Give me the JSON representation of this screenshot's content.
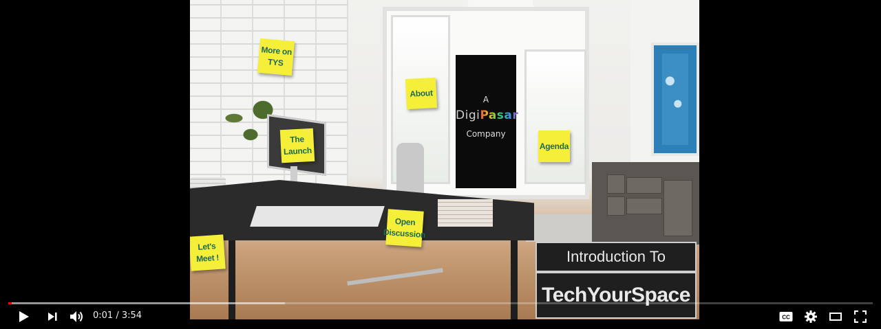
{
  "video": {
    "notes": {
      "more_on_tys": "More on\nTYS",
      "about": "About",
      "the_launch": "The\nLaunch",
      "agenda": "Agenda",
      "open_discussion": "Open\nDiscussion",
      "lets_meet": "Let's\nMeet !"
    },
    "sign": {
      "a": "A",
      "brand_part1": "Digi",
      "brand_part2": "Pasar",
      "company": "Company"
    },
    "title_card": {
      "line1": "Introduction To",
      "line2": "TechYourSpace"
    },
    "colors": {
      "note_yellow": "#f6ef3a",
      "note_text": "#1d6b56"
    }
  },
  "controls": {
    "time_current": "0:01",
    "time_separator": " / ",
    "time_total": "3:54",
    "progress_played_fraction": 0.004,
    "progress_buffered_fraction": 0.32,
    "accent_color": "#ff0000",
    "icons": [
      "play-icon",
      "next-icon",
      "volume-icon",
      "captions-icon",
      "settings-icon",
      "theater-icon",
      "fullscreen-icon"
    ]
  }
}
